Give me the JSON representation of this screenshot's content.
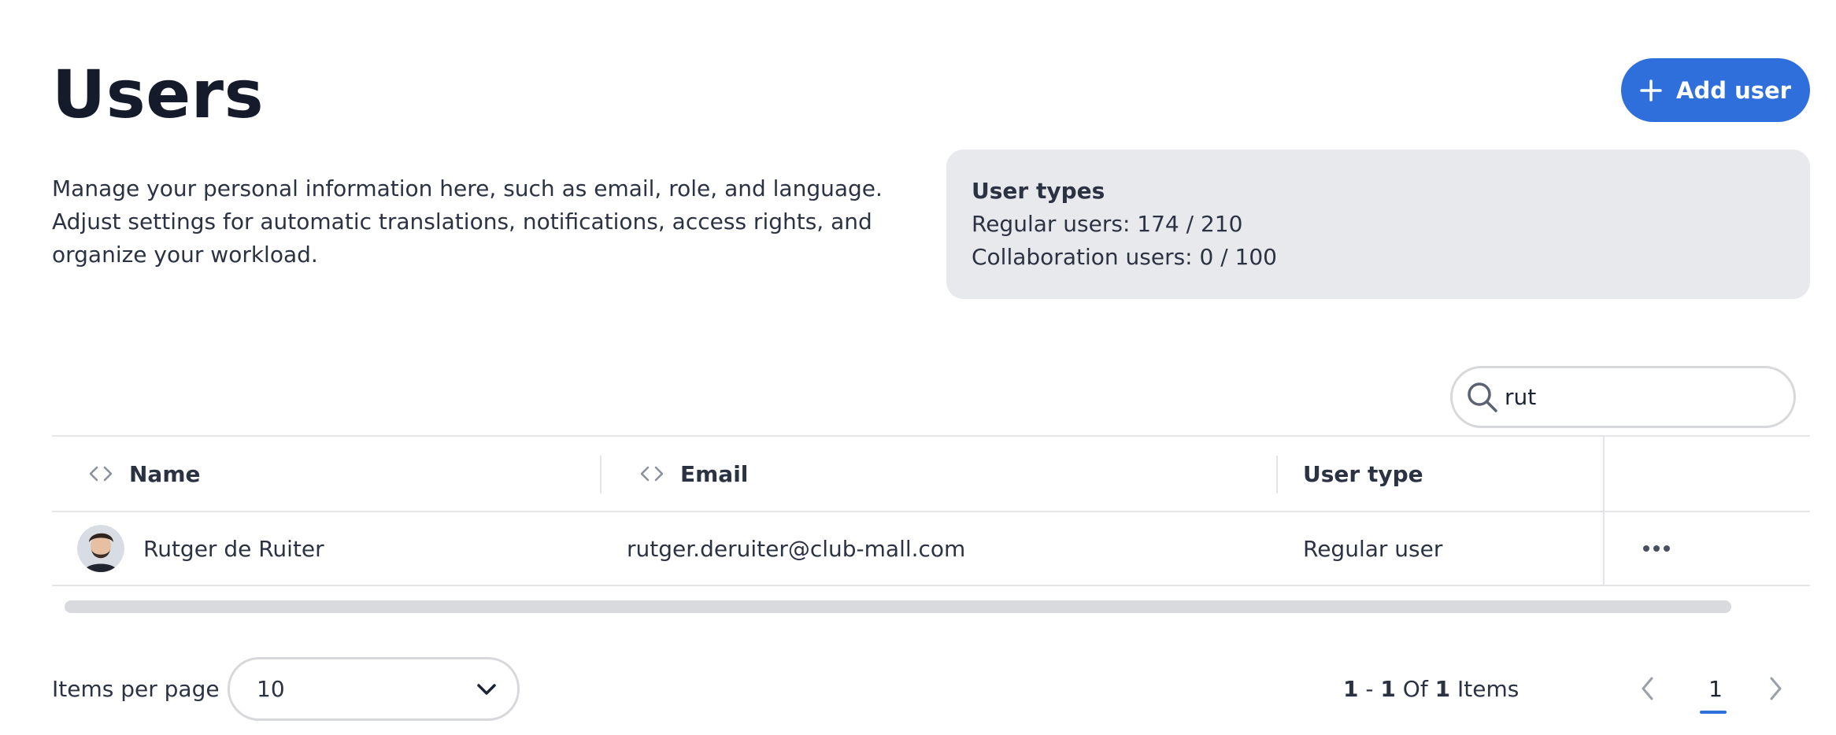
{
  "header": {
    "title": "Users",
    "add_user_label": "Add user",
    "description": "Manage your personal information here, such as email, role, and language. Adjust settings for automatic translations, notifications, access rights, and organize your workload."
  },
  "user_types": {
    "title": "User types",
    "regular": "Regular users: 174 / 210",
    "collaboration": "Collaboration users: 0 / 100"
  },
  "search": {
    "value": "rut",
    "icon": "search-icon"
  },
  "table": {
    "columns": [
      {
        "label": "Name",
        "sortable": true
      },
      {
        "label": "Email",
        "sortable": true
      },
      {
        "label": "User type",
        "sortable": false
      }
    ],
    "rows": [
      {
        "name": "Rutger de Ruiter",
        "email": "rutger.deruiter@club-mall.com",
        "user_type": "Regular user"
      }
    ]
  },
  "pagination": {
    "items_per_page_label": "Items per page",
    "page_size": "10",
    "range_start": "1",
    "range_dash": "-",
    "range_end": "1",
    "of_label": "Of",
    "total": "1",
    "items_label": "Items",
    "current_page": "1"
  },
  "colors": {
    "accent": "#2f6fdc",
    "card_background": "#e8e9ec",
    "border": "#d7d8db"
  }
}
